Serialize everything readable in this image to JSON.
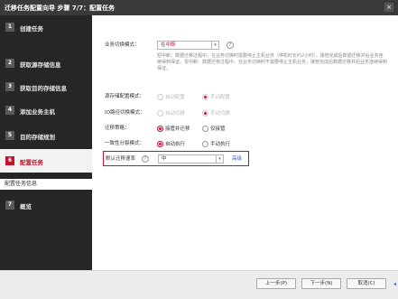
{
  "window": {
    "title": "迁移任务配置向导 步骤 7/7：配置任务",
    "close_label": "×"
  },
  "sidebar": {
    "items": [
      {
        "num": "1",
        "label": "创建任务"
      },
      {
        "num": "2",
        "label": "获取源存储信息"
      },
      {
        "num": "3",
        "label": "获取目的存储信息"
      },
      {
        "num": "4",
        "label": "添加业务主机"
      },
      {
        "num": "5",
        "label": "目的存储规划"
      },
      {
        "num": "6",
        "label": "配置任务"
      },
      {
        "num": "7",
        "label": "概览"
      }
    ],
    "sub_item": "配置任务信息"
  },
  "form": {
    "switch_mode": {
      "label": "业务切换模式：",
      "value": "在中断",
      "desc": "短中断：数据迁移过程中，在业务切换时需要停止主机业务（停机时长约2小时），接管完成后数据迁移并后业务连续得到保证。零中断：数据迁移过程中，在业务切换时不需要停止主机业务，接管完成后数据迁移并后业务连续得到保证。"
    },
    "source_config": {
      "label": "源存储配置模式：",
      "options": [
        "自动配置",
        "手动配置"
      ]
    },
    "io_switch": {
      "label": "IO路径切换模式：",
      "options": [
        "自动切换",
        "手动切换"
      ]
    },
    "migration_policy": {
      "label": "迁移策略：",
      "options": [
        "接管并迁移",
        "仅接管"
      ]
    },
    "consistency": {
      "label": "一致性分裂模式：",
      "options": [
        "自动执行",
        "手动执行"
      ]
    },
    "rate": {
      "label": "默认迁移速率",
      "value": "中",
      "link": "高级"
    }
  },
  "footer": {
    "prev": "上一步(P)",
    "next": "下一步(N)",
    "cancel": "取消(C)"
  },
  "icons": {
    "dropdown": "chevron-down-icon",
    "help": "question-icon"
  },
  "colors": {
    "accent": "#c8102e",
    "sidebar": "#262626",
    "titlebar": "#3a3a3a"
  }
}
